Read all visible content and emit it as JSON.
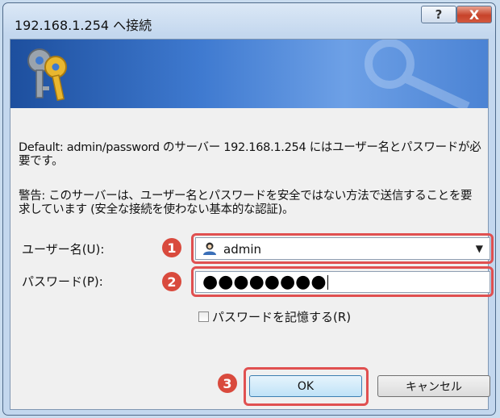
{
  "window": {
    "title": "192.168.1.254 へ接続",
    "help_symbol": "?",
    "close_symbol": "X"
  },
  "message": {
    "line1": "Default: admin/password のサーバー 192.168.1.254 にはユーザー名とパスワードが必要です。",
    "line2": "警告: このサーバーは、ユーザー名とパスワードを安全ではない方法で送信することを要求しています (安全な接続を使わない基本的な認証)。"
  },
  "fields": {
    "username_label": "ユーザー名(U):",
    "username_value": "admin",
    "password_label": "パスワード(P):",
    "password_masked": "●●●●●●●●"
  },
  "remember_label": "パスワードを記憶する(R)",
  "remember_checked": false,
  "buttons": {
    "ok": "OK",
    "cancel": "キャンセル"
  },
  "annotations": [
    "1",
    "2",
    "3"
  ],
  "colors": {
    "annotation": "#e05050",
    "banner": "#3f7ad0"
  }
}
